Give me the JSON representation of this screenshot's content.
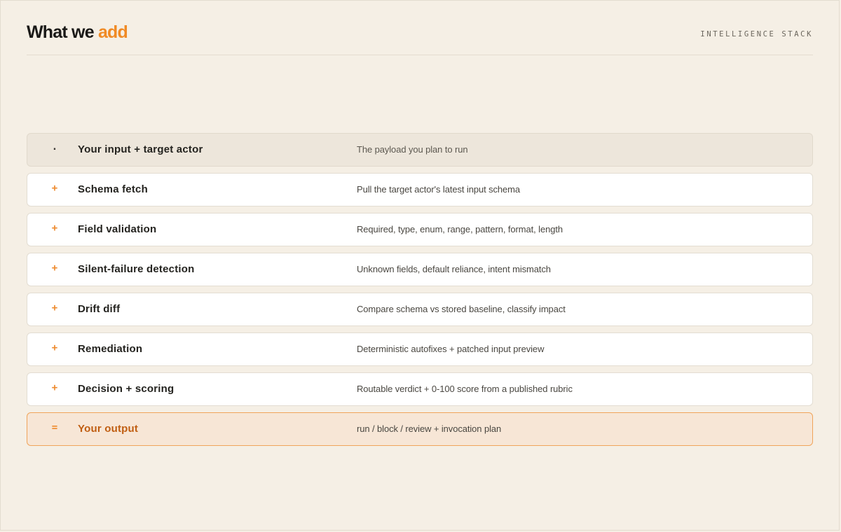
{
  "header": {
    "title_main": "What we ",
    "title_accent": "add",
    "label": "INTELLIGENCE STACK"
  },
  "colors": {
    "accent": "#f08a24",
    "background": "#f5efe5",
    "output_text": "#c05e12"
  },
  "rows": [
    {
      "symbol": ".",
      "name": "Your input + target actor",
      "description": "The payload you plan to run"
    },
    {
      "symbol": "+",
      "name": "Schema fetch",
      "description": "Pull the target actor's latest input schema"
    },
    {
      "symbol": "+",
      "name": "Field validation",
      "description": "Required, type, enum, range, pattern, format, length"
    },
    {
      "symbol": "+",
      "name": "Silent-failure detection",
      "description": "Unknown fields, default reliance, intent mismatch"
    },
    {
      "symbol": "+",
      "name": "Drift diff",
      "description": "Compare schema vs stored baseline, classify impact"
    },
    {
      "symbol": "+",
      "name": "Remediation",
      "description": "Deterministic autofixes + patched input preview"
    },
    {
      "symbol": "+",
      "name": "Decision + scoring",
      "description": "Routable verdict + 0-100 score from a published rubric"
    },
    {
      "symbol": "=",
      "name": "Your output",
      "description": "run / block / review + invocation plan"
    }
  ]
}
